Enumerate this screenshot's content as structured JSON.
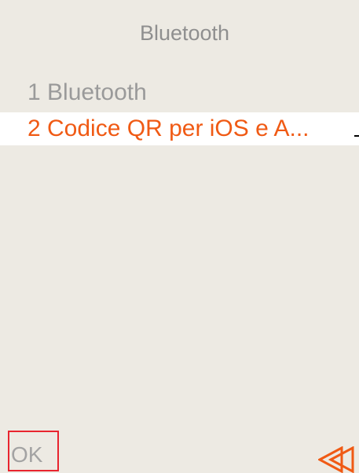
{
  "screen": {
    "title": "Bluetooth"
  },
  "menu": {
    "items": [
      {
        "number": "1",
        "label": "1 Bluetooth",
        "state": "normal"
      },
      {
        "number": "2",
        "label": "2 Codice QR per iOS e A...",
        "state": "selected"
      }
    ]
  },
  "footer": {
    "ok_label": "OK",
    "back_icon": "double-chevron-left-icon"
  },
  "colors": {
    "background": "#edeae3",
    "selected_text": "#f05a14",
    "selected_row": "#ffffff",
    "normal_text": "#9a9a9a",
    "ok_border": "#e8242e",
    "back_icon": "#f05a14"
  }
}
